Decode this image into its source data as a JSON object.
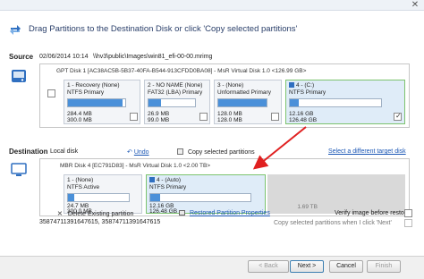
{
  "header": {
    "title": "Drag Partitions to the Destination Disk or click 'Copy selected partitions'"
  },
  "source": {
    "label": "Source",
    "date": "02/06/2014 10:14",
    "path": "\\\\hv3\\public\\Images\\win81_efi-00-00.mrimg",
    "disk_header": "GPT Disk 1 [AC38AC5B-5B37-40FA-B544-913CFDD0BA08] - MsR    Virtual Disk    1.0  <126.99 GB>",
    "partitions": [
      {
        "title": "1 - Recovery (None)",
        "type": "NTFS Primary",
        "used": "284.4 MB",
        "total": "300.0 MB",
        "fill": 0.95,
        "checked": false
      },
      {
        "title": "2 - NO NAME (None)",
        "type": "FAT32 (LBA) Primary",
        "used": "26.9 MB",
        "total": "99.0 MB",
        "fill": 0.27,
        "checked": false
      },
      {
        "title": "3 - (None)",
        "type": "Unformatted Primary",
        "used": "128.0 MB",
        "total": "128.0 MB",
        "fill": 1.0,
        "checked": false
      },
      {
        "title": "4 - (C:)",
        "type": "NTFS Primary",
        "used": "12.16 GB",
        "total": "126.48 GB",
        "fill": 0.1,
        "checked": true
      }
    ]
  },
  "destination": {
    "label": "Destination",
    "local": "Local disk",
    "undo": "Undo",
    "copy_selected": "Copy selected partitions",
    "select_target": "Select a different target disk",
    "disk_header": "MBR Disk 4 [EC791D83] - MsR    Virtual Disk    1.0  <2.00 TB>",
    "partitions": [
      {
        "title": "1 - (None)",
        "type": "NTFS Active",
        "used": "24.7 MB",
        "total": "300.0 MB",
        "fill": 0.1
      },
      {
        "title": "4 - (Auto)",
        "type": "NTFS Primary",
        "used": "12.16 GB",
        "total": "126.48 GB",
        "fill": 0.1
      }
    ],
    "unallocated": "1.69 TB"
  },
  "options": {
    "delete_existing": "Delete Existing partition",
    "restored_props": "Restored Partition Properties",
    "verify": "Verify image before restore",
    "copy_on_next": "Copy selected partitions when I click 'Next'",
    "id1": "35874711391647615, 35874711391647615"
  },
  "buttons": {
    "back": "< Back",
    "next": "Next >",
    "cancel": "Cancel",
    "finish": "Finish"
  },
  "colors": {
    "accent": "#4a90d9",
    "arrow": "#e02020",
    "selected_border": "#7cc36e"
  }
}
